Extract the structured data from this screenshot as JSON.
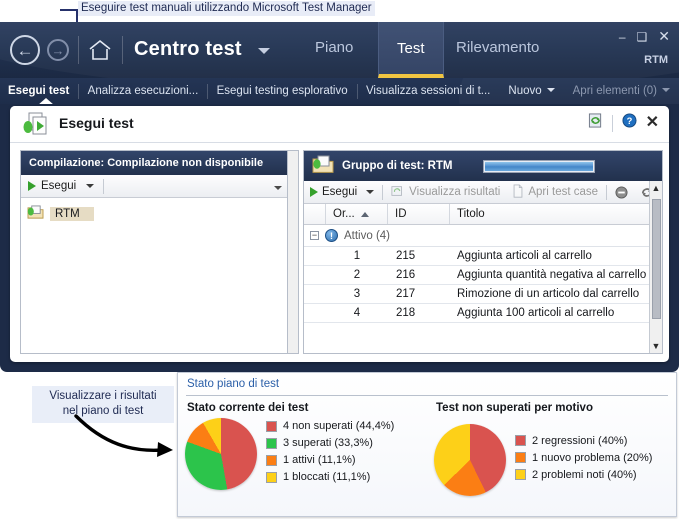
{
  "callouts": {
    "top": "Eseguire test manuali utilizzando Microsoft Test Manager",
    "bottom_line1": "Visualizzare i risultati",
    "bottom_line2": "nel piano di test"
  },
  "titlebar": {
    "app_title": "Centro test",
    "back_icon": "back-arrow-icon",
    "forward_icon": "forward-arrow-icon",
    "home_icon": "home-icon",
    "dropdown_icon": "chevron-down-icon",
    "tabs": [
      {
        "label": "Piano",
        "active": false
      },
      {
        "label": "Test",
        "active": true
      },
      {
        "label": "Rilevamento",
        "active": false
      }
    ],
    "window_buttons": {
      "minimize": "–",
      "maximize": "❑",
      "close": "✕"
    },
    "rtm_label": "RTM"
  },
  "menustrip": {
    "items": [
      {
        "label": "Esegui test",
        "style": "first"
      },
      {
        "label": "Analizza esecuzioni...",
        "style": "normal"
      },
      {
        "label": "Esegui testing esplorativo",
        "style": "normal"
      },
      {
        "label": "Visualizza sessioni di t...",
        "style": "normal"
      },
      {
        "label": "Nuovo",
        "style": "caret"
      },
      {
        "label": "Apri elementi (0)",
        "style": "dim-caret"
      }
    ]
  },
  "panel": {
    "title": "Esegui test",
    "icon": "run-tests-icon",
    "tools": {
      "refresh_icon": "refresh-icon",
      "help_icon": "help-icon",
      "close_icon": "close-icon"
    }
  },
  "left_pane": {
    "header": "Compilazione: Compilazione non disponibile",
    "toolbar": {
      "run_label": "Esegui",
      "run_icon": "play-icon",
      "caret_icon": "chevron-down-icon",
      "overflow_icon": "overflow-chevron-icon"
    },
    "tree_item": {
      "label": "RTM",
      "icon": "test-suite-icon"
    }
  },
  "right_pane": {
    "header": "Gruppo di test: RTM",
    "header_icon": "test-suite-icon",
    "progress_percent": 100,
    "toolbar": [
      {
        "label": "Esegui",
        "icon": "play-icon",
        "disabled": false,
        "caret": true
      },
      {
        "label": "Visualizza risultati",
        "icon": "view-results-icon",
        "disabled": true,
        "caret": false
      },
      {
        "label": "Apri test case",
        "icon": "open-testcase-icon",
        "disabled": true,
        "caret": false
      }
    ],
    "toolbar_right_icons": [
      "block-icon",
      "reset-icon"
    ],
    "columns": [
      "Or...",
      "ID",
      "Titolo"
    ],
    "sort_column": "Or...",
    "sort_direction": "asc",
    "group_row": {
      "expander": "−",
      "icon": "info-icon",
      "label": "Attivo (4)"
    },
    "rows": [
      {
        "order": "1",
        "id": "215",
        "title": "Aggiunta articoli al carrello"
      },
      {
        "order": "2",
        "id": "216",
        "title": "Aggiunta quantità negativa al carrello"
      },
      {
        "order": "3",
        "id": "217",
        "title": "Rimozione di un articolo dal carrello"
      },
      {
        "order": "4",
        "id": "218",
        "title": "Aggiunta 100 articoli al carrello"
      }
    ],
    "scroll_up_icon": "scroll-up-icon",
    "scroll_down_icon": "scroll-down-icon"
  },
  "chart_card": {
    "title": "Stato piano di test"
  },
  "chart_data": [
    {
      "type": "pie",
      "title": "Stato corrente dei test",
      "legend_position": "right",
      "categories": [
        "4 non superati",
        "3 superati",
        "1 attivi",
        "1 bloccati"
      ],
      "values": [
        4,
        3,
        1,
        1
      ],
      "percents": [
        "44,4%",
        "33,3%",
        "11,1%",
        "11,1%"
      ],
      "colors": [
        "#d9534f",
        "#2cc44b",
        "#fb7e14",
        "#fdd018"
      ],
      "labels": [
        "4 non superati (44,4%)",
        "3 superati (33,3%)",
        "1 attivi (11,1%)",
        "1 bloccati (11,1%)"
      ]
    },
    {
      "type": "pie",
      "title": "Test non superati per motivo",
      "legend_position": "right",
      "categories": [
        "2 regressioni",
        "1 nuovo problema",
        "2 problemi noti"
      ],
      "values": [
        2,
        1,
        2
      ],
      "percents": [
        "40%",
        "20%",
        "40%"
      ],
      "colors": [
        "#d9534f",
        "#fb7e14",
        "#fdd018"
      ],
      "labels": [
        "2 regressioni (40%)",
        "1 nuovo problema (20%)",
        "2 problemi noti (40%)"
      ]
    }
  ]
}
